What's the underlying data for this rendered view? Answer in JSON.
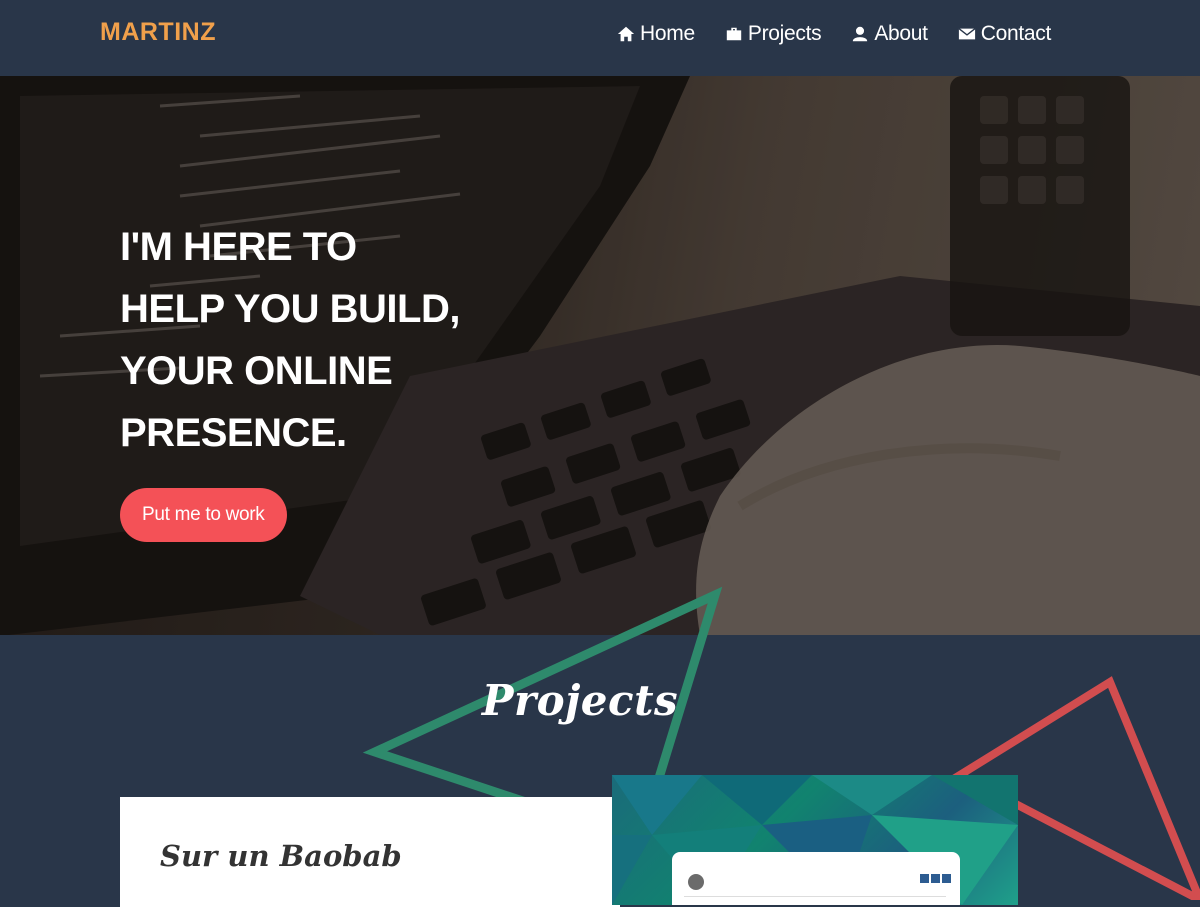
{
  "nav": {
    "brand": "MARTINZ",
    "links": [
      {
        "label": "Home",
        "icon": "home-icon"
      },
      {
        "label": "Projects",
        "icon": "briefcase-icon"
      },
      {
        "label": "About",
        "icon": "user-icon"
      },
      {
        "label": "Contact",
        "icon": "envelope-icon"
      }
    ]
  },
  "hero": {
    "title_lines": [
      "I'M HERE TO",
      "HELP YOU BUILD,",
      "YOUR ONLINE",
      "PRESENCE."
    ],
    "cta_label": "Put me to work"
  },
  "projects": {
    "heading": "Projects",
    "items": [
      {
        "name": "Sur un Baobab"
      }
    ]
  },
  "colors": {
    "navy": "#293649",
    "brand_orange": "#f0a04b",
    "cta_red": "#f45157",
    "triangle_green": "#2e8a6c",
    "triangle_red": "#d24d4f"
  }
}
